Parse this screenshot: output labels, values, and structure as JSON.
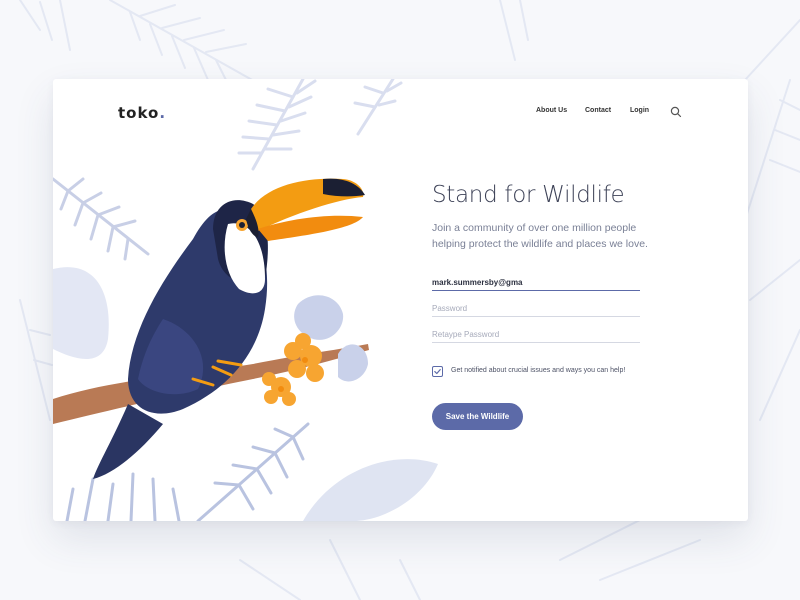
{
  "brand": {
    "name": "toko",
    "dot": "."
  },
  "nav": {
    "items": [
      {
        "label": "About Us"
      },
      {
        "label": "Contact"
      },
      {
        "label": "Login"
      }
    ],
    "search_icon": "search-icon"
  },
  "hero": {
    "title": "Stand for Wildlife",
    "subtitle": "Join a community of over one million people helping protect the wildlife and places we love."
  },
  "form": {
    "email_value": "mark.summersby@gma",
    "password_placeholder": "Password",
    "retype_placeholder": "Retaype Password",
    "notify_label": "Get notified about crucial issues and ways you can help!",
    "notify_checked": true,
    "submit_label": "Save the Wildlife"
  },
  "colors": {
    "accent": "#5c6aa8",
    "leaf": "#d9deef",
    "toucan_body": "#2e3a6b",
    "beak": "#f39c12",
    "flower": "#f7a531"
  }
}
